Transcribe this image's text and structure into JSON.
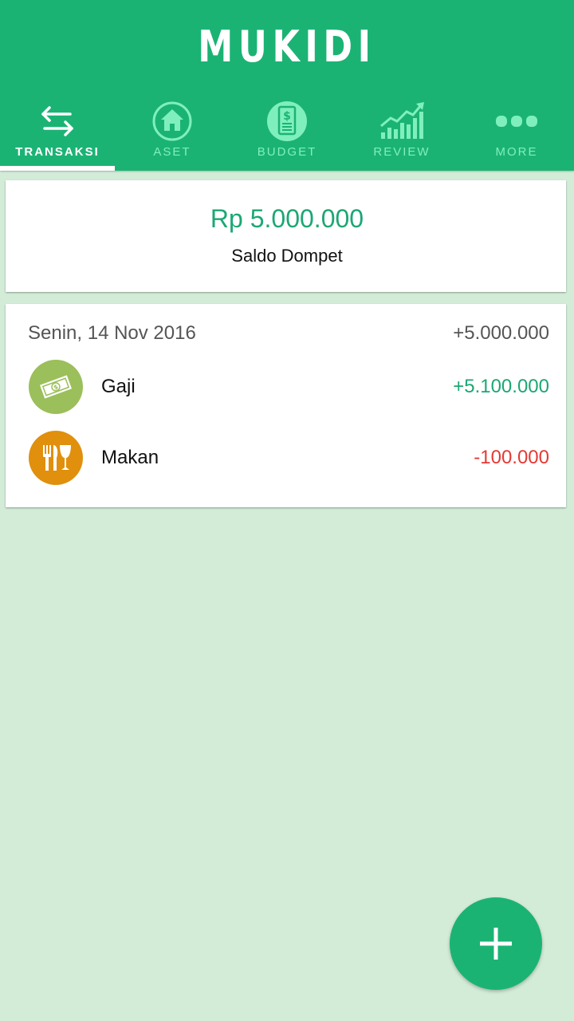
{
  "app": {
    "title": "MUKIDI"
  },
  "tabs": [
    {
      "label": "TRANSAKSI",
      "icon": "swap-arrows-icon",
      "active": true
    },
    {
      "label": "ASET",
      "icon": "house-icon",
      "active": false
    },
    {
      "label": "BUDGET",
      "icon": "dollar-document-icon",
      "active": false
    },
    {
      "label": "REVIEW",
      "icon": "growth-chart-icon",
      "active": false
    },
    {
      "label": "MORE",
      "icon": "more-dots-icon",
      "active": false
    }
  ],
  "balance": {
    "amount": "Rp 5.000.000",
    "label": "Saldo Dompet"
  },
  "day": {
    "label": "Senin, 14 Nov 2016",
    "total": "+5.000.000",
    "transactions": [
      {
        "name": "Gaji",
        "amount": "+5.100.000",
        "icon": "money-icon",
        "amount_color": "#1ca774",
        "icon_color": "#9bbf5a"
      },
      {
        "name": "Makan",
        "amount": "-100.000",
        "icon": "cutlery-icon",
        "amount_color": "#e53935",
        "icon_color": "#e0900d"
      }
    ]
  },
  "colors": {
    "primary": "#1bb374",
    "background": "#d3ecd8",
    "tab_inactive": "#7ff0bd"
  },
  "fab": {
    "icon": "plus-icon"
  }
}
